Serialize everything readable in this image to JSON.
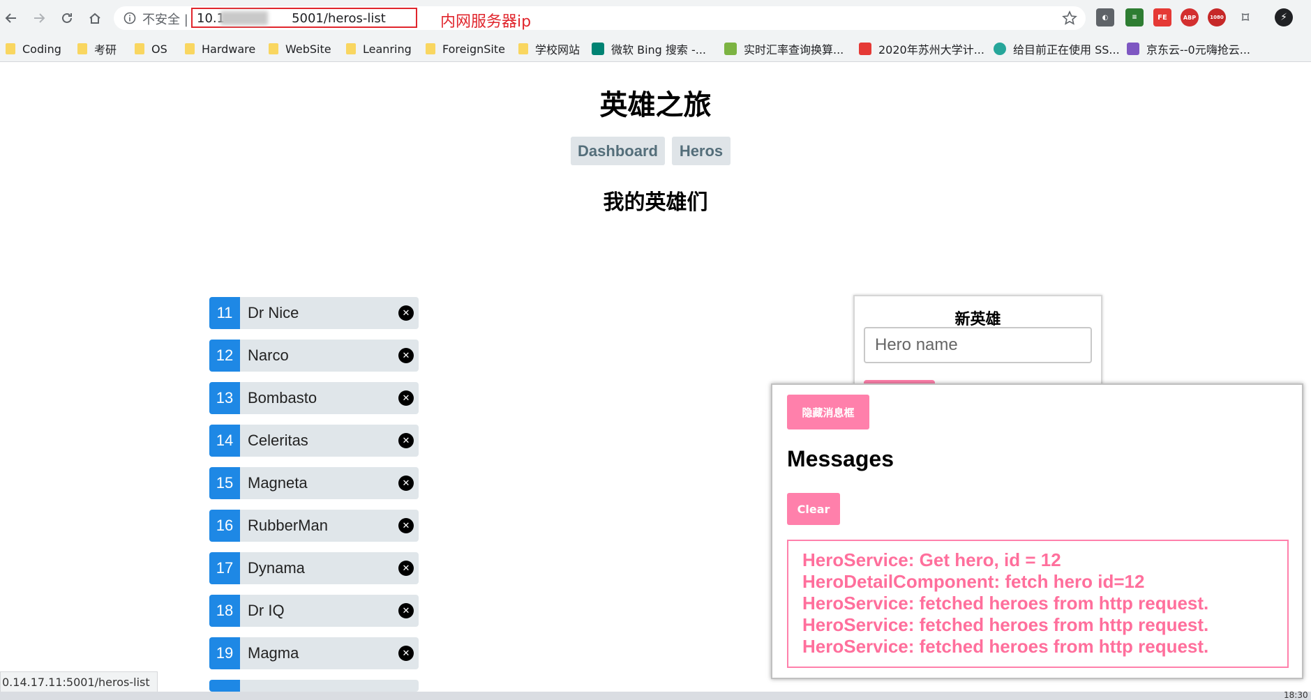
{
  "browser": {
    "insecure_label": "不安全 |",
    "url_prefix": "10.1",
    "url_suffix": "5001/heros-list",
    "annotation": "内网服务器ip",
    "bookmarks": [
      {
        "label": "Coding",
        "kind": "folder"
      },
      {
        "label": "考研",
        "kind": "folder"
      },
      {
        "label": "OS",
        "kind": "folder"
      },
      {
        "label": "Hardware",
        "kind": "folder"
      },
      {
        "label": "WebSite",
        "kind": "folder"
      },
      {
        "label": "Leanring",
        "kind": "folder"
      },
      {
        "label": "ForeignSite",
        "kind": "folder"
      },
      {
        "label": "学校网站",
        "kind": "folder"
      },
      {
        "label": "微软 Bing 搜索 -...",
        "kind": "bing"
      },
      {
        "label": "实时汇率查询换算...",
        "kind": "site"
      },
      {
        "label": "2020年苏州大学计...",
        "kind": "site"
      },
      {
        "label": "给目前正在使用 SS...",
        "kind": "site"
      },
      {
        "label": "京东云--0元嗨抢云...",
        "kind": "site"
      }
    ],
    "status_url": "0.14.17.11:5001/heros-list",
    "clock": "18:30"
  },
  "page": {
    "title": "英雄之旅",
    "nav": {
      "dashboard": "Dashboard",
      "heros": "Heros"
    },
    "subtitle": "我的英雄们",
    "heroes": [
      {
        "id": "11",
        "name": "Dr Nice"
      },
      {
        "id": "12",
        "name": "Narco"
      },
      {
        "id": "13",
        "name": "Bombasto"
      },
      {
        "id": "14",
        "name": "Celeritas"
      },
      {
        "id": "15",
        "name": "Magneta"
      },
      {
        "id": "16",
        "name": "RubberMan"
      },
      {
        "id": "17",
        "name": "Dynama"
      },
      {
        "id": "18",
        "name": "Dr IQ"
      },
      {
        "id": "19",
        "name": "Magma"
      }
    ],
    "new_hero": {
      "label": "新英雄",
      "placeholder": "Hero name"
    },
    "messages": {
      "hide_button": "隐藏消息框",
      "title": "Messages",
      "clear_button": "Clear",
      "items": [
        "HeroService: Get hero, id = 12",
        "HeroDetailComponent: fetch hero id=12",
        "HeroService: fetched heroes from http request.",
        "HeroService: fetched heroes from http request.",
        "HeroService: fetched heroes from http request."
      ]
    }
  },
  "colors": {
    "accent_pink": "#ff80ab",
    "hero_id_blue": "#1e88e5",
    "annotation_red": "#e0252c"
  }
}
